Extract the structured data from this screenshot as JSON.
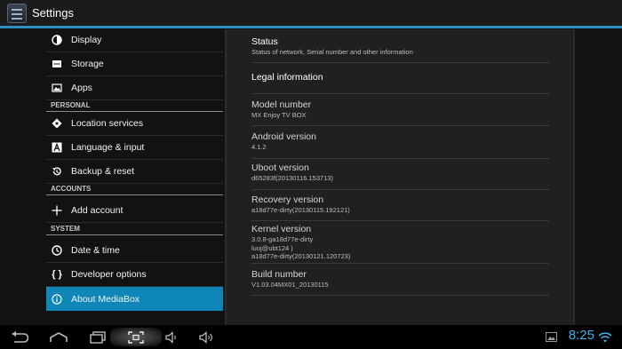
{
  "actionbar": {
    "title": "Settings"
  },
  "nav": {
    "items": [
      {
        "label": "Display",
        "icon": "display-icon"
      },
      {
        "label": "Storage",
        "icon": "storage-icon"
      },
      {
        "label": "Apps",
        "icon": "apps-icon"
      },
      {
        "label": "Location services",
        "icon": "location-icon"
      },
      {
        "label": "Language & input",
        "icon": "language-icon"
      },
      {
        "label": "Backup & reset",
        "icon": "backup-icon"
      },
      {
        "label": "Add account",
        "icon": "plus-icon"
      },
      {
        "label": "Date & time",
        "icon": "clock-icon"
      },
      {
        "label": "Developer options",
        "icon": "braces-icon"
      },
      {
        "label": "About MediaBox",
        "icon": "info-icon"
      }
    ],
    "sections": {
      "personal": "PERSONAL",
      "accounts": "ACCOUNTS",
      "system": "SYSTEM"
    },
    "active_index": 9,
    "accent_color": "#0e86b8"
  },
  "about": {
    "status": {
      "title": "Status",
      "subtitle": "Status of network, Serial number and other information"
    },
    "legal": {
      "title": "Legal information"
    },
    "model": {
      "title": "Model number",
      "value": "MX Enjoy TV BOX"
    },
    "android": {
      "title": "Android version",
      "value": "4.1.2"
    },
    "uboot": {
      "title": "Uboot version",
      "value": "d65283f(20130116.153713)"
    },
    "recovery": {
      "title": "Recovery version",
      "value": "a18d77e-dirty(20130115.192121)"
    },
    "kernel": {
      "title": "Kernel version",
      "value": "3.0.8-ga18d77e-dirty\nluoj@ubt124 )\na18d77e-dirty(20130121.120723)"
    },
    "build": {
      "title": "Build number",
      "value": "V1.03.04MX01_20130115"
    }
  },
  "statusbar": {
    "time": "8:25",
    "icons": [
      "back-icon",
      "home-icon",
      "recent-apps-icon",
      "screenshot-icon",
      "volume-down-icon",
      "volume-up-icon",
      "gallery-icon",
      "wifi-icon"
    ],
    "clock_color": "#3fb3e8"
  }
}
